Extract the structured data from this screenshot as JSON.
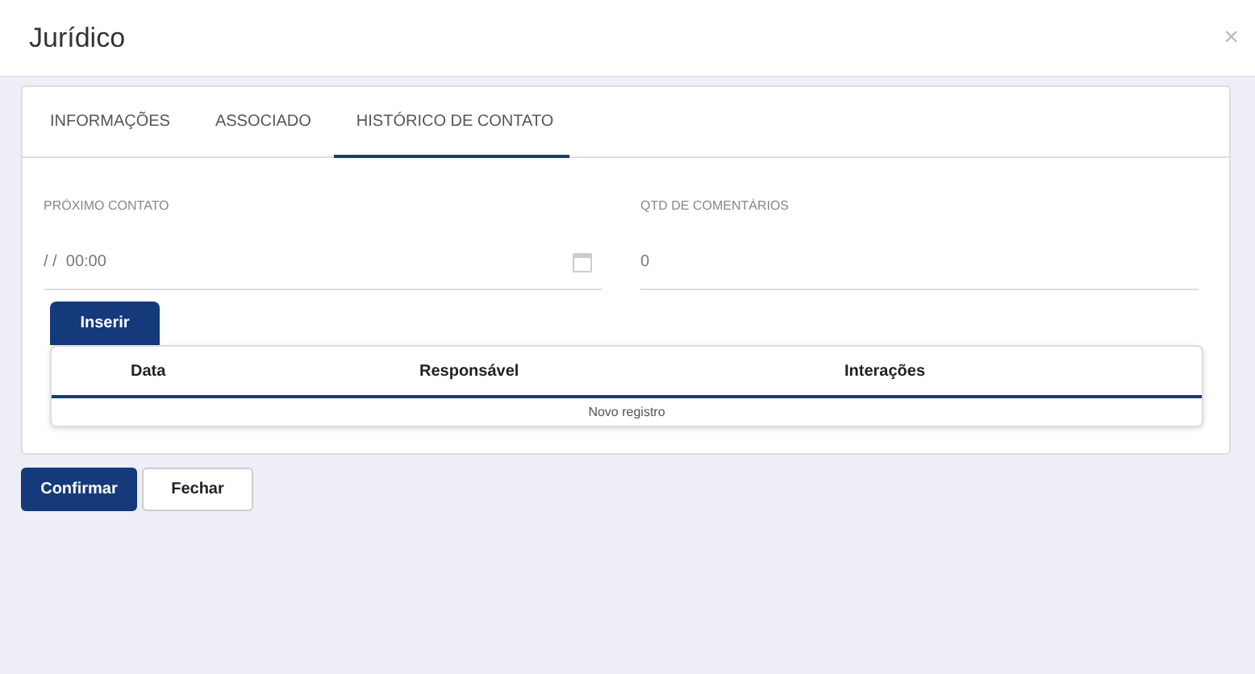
{
  "window": {
    "title": "Jurídico",
    "close": "×"
  },
  "tabs": [
    {
      "label": "INFORMAÇÕES",
      "selected": false
    },
    {
      "label": "ASSOCIADO",
      "selected": false
    },
    {
      "label": "HISTÓRICO DE CONTATO",
      "selected": true
    }
  ],
  "fields": [
    {
      "label": "PRÓXIMO CONTATO",
      "value": "/ /  00:00",
      "kind": "date"
    },
    {
      "label": "QTD DE COMENTÁRIOS",
      "value": "0",
      "kind": "text"
    }
  ],
  "insert_button": "Inserir",
  "table": {
    "columns": [
      "",
      "Data",
      "Responsável",
      "Interações"
    ],
    "empty_row": "Novo registro"
  },
  "buttons": [
    {
      "label": "Confirmar",
      "kind": "primary"
    },
    {
      "label": "Fechar",
      "kind": "secondary"
    }
  ]
}
